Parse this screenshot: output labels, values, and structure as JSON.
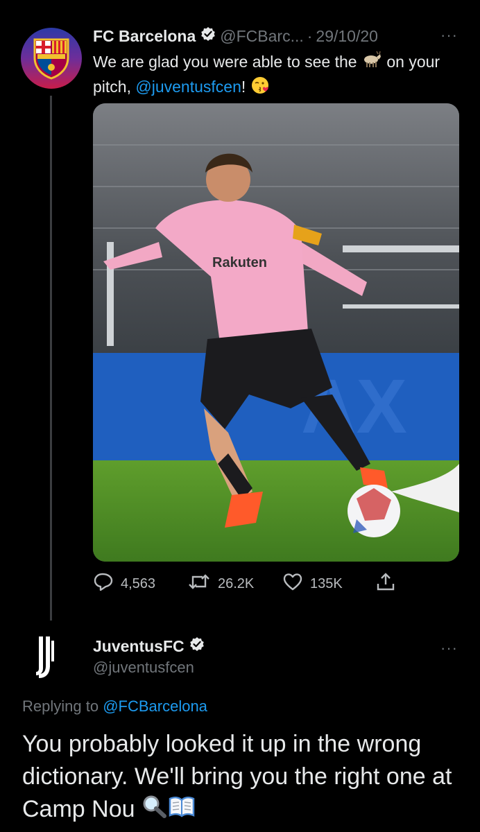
{
  "tweet1": {
    "author_name": "FC Barcelona",
    "handle": "@FCBarc...",
    "dot": "·",
    "date": "29/10/20",
    "more_icon": "···",
    "text_part1": "We are glad you were able to see the ",
    "text_part2": " on your pitch, ",
    "mention": "@juventusfcen",
    "text_part3": "!",
    "emoji_goat": "goat-emoji",
    "emoji_kiss": "face-blowing-kiss-emoji",
    "photo": "player-dribbling-photo",
    "metrics": {
      "replies": "4,563",
      "retweets": "26.2K",
      "likes": "135K"
    }
  },
  "reply": {
    "author_name": "JuventusFC",
    "handle": "@juventusfcen",
    "more_icon": "···",
    "replying_prefix": "Replying to ",
    "replying_to": "@FCBarcelona",
    "text": "You probably looked it up in the wrong dictionary. We'll bring you the right one at Camp Nou "
  },
  "colors": {
    "background": "#000000",
    "text": "#e7e9ea",
    "muted": "#71767b",
    "link": "#1d9bf0"
  }
}
